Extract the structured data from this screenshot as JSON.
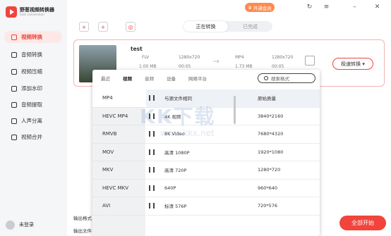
{
  "app": {
    "name": "野葱视频转换器",
    "sub": "Fast conversion"
  },
  "nav": [
    {
      "label": "视频转换",
      "icon": "video-convert-icon",
      "active": true
    },
    {
      "label": "音频转换",
      "icon": "audio-convert-icon"
    },
    {
      "label": "视频压缩",
      "icon": "compress-icon"
    },
    {
      "label": "添加水印",
      "icon": "watermark-icon"
    },
    {
      "label": "音频提取",
      "icon": "audio-extract-icon"
    },
    {
      "label": "人声分离",
      "icon": "voice-split-icon"
    },
    {
      "label": "视频合并",
      "icon": "merge-icon"
    }
  ],
  "user": {
    "label": "未登录"
  },
  "header": {
    "vip": "开通会员",
    "tabs": [
      "正在转换",
      "已完成"
    ]
  },
  "file": {
    "name": "test",
    "src_format": "FLV",
    "src_res": "1280x720",
    "src_size": "1.00 MB",
    "src_time": "00:05",
    "dst_format": "MP4",
    "dst_res": "1280x720",
    "dst_size": "1.73 MB",
    "dst_time": "00:05",
    "convert": "极速转换"
  },
  "popup": {
    "tabs": [
      "最近",
      "视频",
      "音频",
      "设备",
      "网络平台"
    ],
    "search_placeholder": "搜索格式",
    "formats": [
      "MP4",
      "HEVC MP4",
      "RMVB",
      "MOV",
      "MKV",
      "HEVC MKV",
      "AVI"
    ],
    "rows": [
      {
        "name": "与源文件相同",
        "res": "原始质量"
      },
      {
        "name": "4K 视频",
        "res": "3840*2160"
      },
      {
        "name": "8K Video",
        "res": "7680*4320"
      },
      {
        "name": "高清 1080P",
        "res": "1920*1080"
      },
      {
        "name": "高清 720P",
        "res": "1280*720"
      },
      {
        "name": "640P",
        "res": "960*640"
      },
      {
        "name": "标清 576P",
        "res": "720*576"
      }
    ]
  },
  "bottom": {
    "out_format": "输出格式",
    "out_folder": "输出文件",
    "start_all": "全部开始"
  },
  "watermark": {
    "big": "KK下载",
    "small": "www.kkx.net"
  }
}
